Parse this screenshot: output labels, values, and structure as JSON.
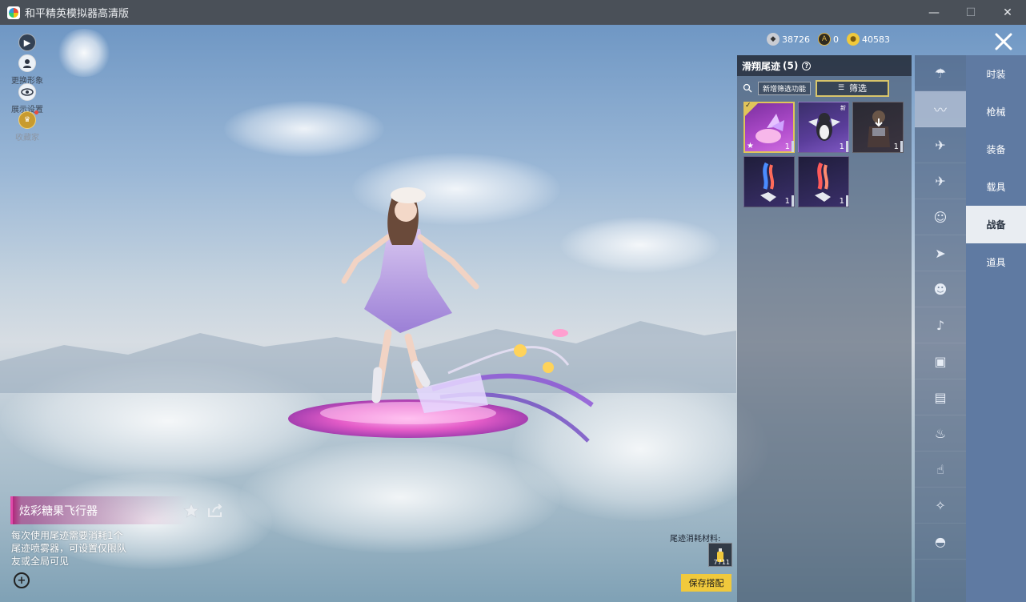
{
  "window": {
    "title": "和平精英模拟器高清版",
    "controls": {
      "minimize": "—",
      "maximize": "☐",
      "close": "✕"
    }
  },
  "left_tools": [
    {
      "label": "",
      "icon": "play-icon"
    },
    {
      "label": "更换形象",
      "icon": "person-icon"
    },
    {
      "label": "展示设置",
      "icon": "eye-icon"
    },
    {
      "label": "收藏家",
      "icon": "collector-badge-icon"
    }
  ],
  "currency": [
    {
      "value": "38726",
      "icon": "silver-coin-icon",
      "color": "#c9ccd3"
    },
    {
      "value": "0",
      "icon": "gold-emblem-icon",
      "color": "#e1b64a"
    },
    {
      "value": "40583",
      "icon": "gold-coin-icon",
      "color": "#f0c93c"
    }
  ],
  "panel": {
    "title": "滑翔尾迹",
    "count": "(5)",
    "new_filter_label": "新增筛选功能",
    "filter_label": "筛选",
    "items": [
      {
        "count": "1",
        "style": "selected",
        "label": "炫彩糖果飞行器"
      },
      {
        "count": "1",
        "style": "purple",
        "label": "企鹅"
      },
      {
        "count": "1",
        "style": "dark",
        "label": ""
      },
      {
        "count": "1",
        "style": "purple",
        "label": ""
      },
      {
        "count": "1",
        "style": "purple",
        "label": ""
      }
    ]
  },
  "rail_icons": [
    "parachute-icon",
    "trail-icon",
    "drone-icon",
    "plane-icon",
    "emote-icon",
    "jet-icon",
    "pet-icon",
    "sound-icon",
    "badge-icon",
    "photo-icon",
    "extinguisher-icon",
    "tap-icon",
    "sparkle-icon",
    "ufo-icon"
  ],
  "categories": [
    {
      "label": "时装",
      "active": false
    },
    {
      "label": "枪械",
      "active": false
    },
    {
      "label": "装备",
      "active": false
    },
    {
      "label": "载具",
      "active": false
    },
    {
      "label": "战备",
      "active": true
    },
    {
      "label": "道具",
      "active": false
    }
  ],
  "item_info": {
    "name": "炫彩糖果飞行器",
    "description": "每次使用尾迹需要消耗1个尾迹喷雾器，可设置仅限队友或全局可见"
  },
  "material": {
    "label": "尾迹消耗材料:",
    "count": "7711"
  },
  "save_label": "保存搭配",
  "colors": {
    "accent_gold": "#f0c93c",
    "active_category_bg": "#e9edf2",
    "rail_bg": "#5f7aa2"
  }
}
